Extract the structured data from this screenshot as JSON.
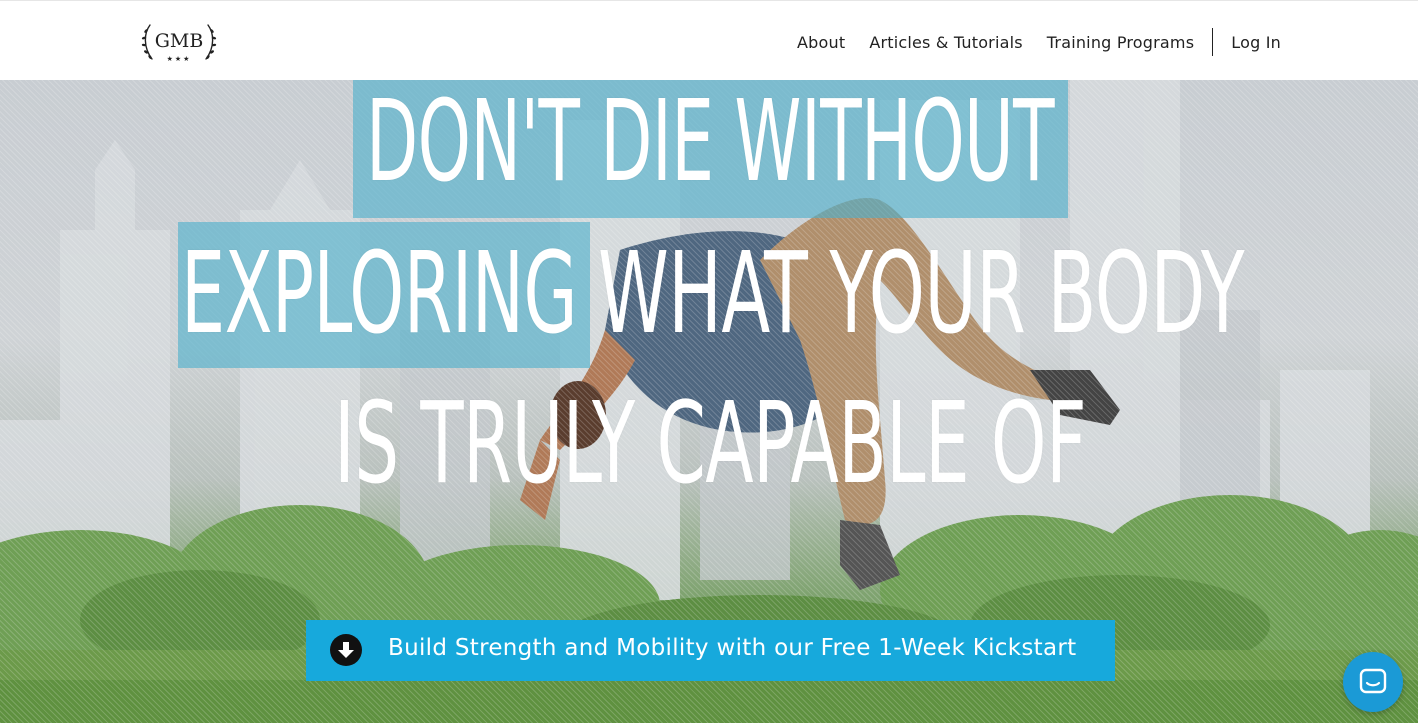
{
  "brand": {
    "logo_text": "GMB",
    "logo_stars": "★★★"
  },
  "nav": {
    "items": [
      {
        "label": "About"
      },
      {
        "label": "Articles & Tutorials"
      },
      {
        "label": "Training Programs"
      }
    ],
    "login_label": "Log In"
  },
  "hero": {
    "headline": {
      "line1": "DON'T DIE WITHOUT",
      "line2_a": "EXPLORING",
      "line2_b": " WHAT YOUR BODY",
      "line3": "IS TRULY CAPABLE OF"
    },
    "highlight_color": "#4eb0cc"
  },
  "cta": {
    "label": "Build Strength and Mobility with our Free 1-Week Kickstart",
    "icon": "arrow-down-circle-icon",
    "color": "#17a9dc"
  },
  "chat": {
    "icon": "chat-bubble-icon",
    "color": "#1b9ad6"
  }
}
